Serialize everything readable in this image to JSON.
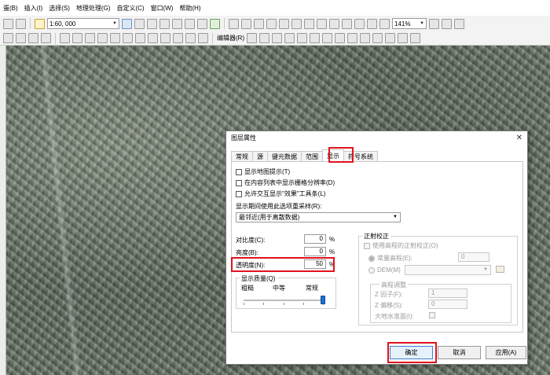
{
  "menubar": {
    "items": [
      "蛋(B)",
      "插入(I)",
      "选择(S)",
      "地理处理(G)",
      "自定义(C)",
      "窗口(W)",
      "帮助(H)"
    ]
  },
  "toolbar": {
    "scale_value": "1:60, 000",
    "zoom_value": "141%",
    "editor_label": "编辑器(R)"
  },
  "dialog": {
    "title": "图层属性",
    "close_icon": "close-icon",
    "tabs": [
      "常规",
      "源",
      "键元数据",
      "范围",
      "显示",
      "符号系统"
    ],
    "active_tab": "显示",
    "checkboxes": [
      "显示地图提示(T)",
      "在内容列表中显示栅格分辨率(D)",
      "允许交互显示\"效果\"工具条(L)"
    ],
    "resample_label": "显示期间使用此选项重采样(R):",
    "resample_value": "最邻近(用于离散数据)",
    "contrast_label": "对比度(C):",
    "contrast_value": "0",
    "brightness_label": "亮度(B):",
    "brightness_value": "0",
    "transparency_label": "透明度(N):",
    "transparency_value": "50",
    "percent": "%",
    "quality_group": "显示质量(Q)",
    "quality_levels": [
      "粗糙",
      "中等",
      "常规"
    ],
    "quality_level": "常规",
    "ortho": {
      "group": "正射校正",
      "use_elevation": "使用高程的正射校正(O)",
      "constant_label": "常量高程(E):",
      "constant_value": "0",
      "dem_label": "DEM(M)",
      "elev_adjust": "高程调整",
      "zfactor_label": "Z 因子(F):",
      "zfactor_value": "1",
      "zoffset_label": "Z 偏移(S):",
      "zoffset_value": "0",
      "geoid_label": "大地水准面(I):"
    },
    "buttons": {
      "ok": "确定",
      "cancel": "取消",
      "apply": "应用(A)"
    }
  },
  "colors": {
    "highlight": "#e0131e",
    "accent": "#1f6fd1"
  }
}
